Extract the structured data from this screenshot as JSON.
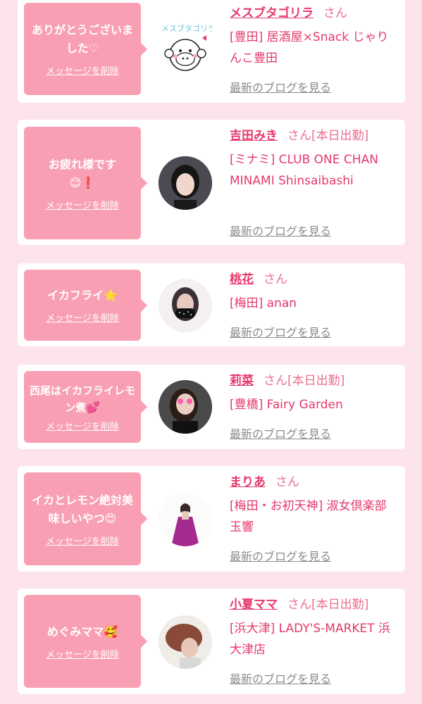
{
  "common": {
    "delete_label": "メッセージを削除",
    "blog_label": "最新のブログを見る"
  },
  "cards": [
    {
      "message": "ありがとうございました♡",
      "message_emoji": "",
      "name": "メスブタゴリラ",
      "honorific": "さん",
      "shop": "[豊田] 居酒屋×Snack じゃりんこ豊田",
      "avatar_icon": "gorilla-illustration-icon",
      "avatar_text": "メスブタゴリラ"
    },
    {
      "message": "お疲れ様です",
      "message_emoji": "😊❗",
      "name": "吉田みき",
      "honorific": "さん[本日出勤]",
      "shop": "[ミナミ] CLUB ONE CHAN MINAMI Shinsaibashi",
      "avatar_icon": "profile-photo-icon"
    },
    {
      "message": "イカフライ",
      "message_emoji": "⭐",
      "name": "桃花",
      "honorific": "さん",
      "shop": "[梅田] anan",
      "avatar_icon": "profile-photo-icon"
    },
    {
      "message": "西尾はイカフライレモン煮",
      "message_emoji": "💕",
      "name": "莉菜",
      "honorific": "さん[本日出勤]",
      "shop": "[豊橋] Fairy Garden",
      "avatar_icon": "profile-photo-icon"
    },
    {
      "message": "イカとレモン絶対美味しいやつ",
      "message_emoji": "😍",
      "name": "まりあ",
      "honorific": "さん",
      "shop": "[梅田・お初天神] 淑女倶楽部 玉響",
      "avatar_icon": "profile-photo-icon"
    },
    {
      "message": "めぐみママ",
      "message_emoji": "🥰",
      "name": "小夏ママ",
      "honorific": "さん[本日出勤]",
      "shop": "[浜大津] LADY'S-MARKET 浜大津店",
      "avatar_icon": "profile-photo-icon"
    }
  ]
}
